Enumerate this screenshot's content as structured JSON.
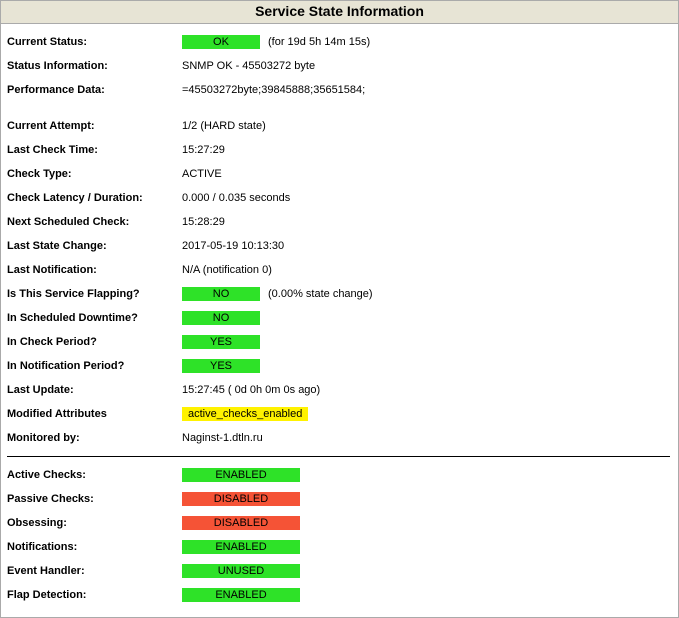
{
  "title": "Service State Information",
  "rows1": {
    "currentStatus": {
      "label": "Current Status:",
      "badge": "OK",
      "extra": "(for 19d 5h 14m 15s)"
    },
    "statusInformation": {
      "label": "Status Information:",
      "value": "SNMP OK - 45503272 byte"
    },
    "performanceData": {
      "label": "Performance Data:",
      "value": "=45503272byte;39845888;35651584;"
    }
  },
  "rows2": {
    "currentAttempt": {
      "label": "Current Attempt:",
      "value": "1/2  (HARD state)"
    },
    "lastCheckTime": {
      "label": "Last Check Time:",
      "value": "15:27:29"
    },
    "checkType": {
      "label": "Check Type:",
      "value": "ACTIVE"
    },
    "checkLatency": {
      "label": "Check Latency / Duration:",
      "value": "0.000 / 0.035 seconds"
    },
    "nextCheck": {
      "label": "Next Scheduled Check:",
      "value": "15:28:29"
    },
    "lastStateChange": {
      "label": "Last State Change:",
      "value": "2017-05-19 10:13:30"
    },
    "lastNotification": {
      "label": "Last Notification:",
      "value": "N/A (notification 0)"
    },
    "flapping": {
      "label": "Is This Service Flapping?",
      "badge": "NO",
      "extra": "(0.00% state change)"
    },
    "scheduledDowntime": {
      "label": "In Scheduled Downtime?",
      "badge": "NO"
    },
    "inCheckPeriod": {
      "label": "In Check Period?",
      "badge": "YES"
    },
    "inNotificationPeriod": {
      "label": "In Notification Period?",
      "badge": "YES"
    },
    "lastUpdate": {
      "label": "Last Update:",
      "value": "15:27:45  ( 0d 0h 0m 0s ago)"
    },
    "modifiedAttributes": {
      "label": "Modified Attributes",
      "badge": "active_checks_enabled"
    },
    "monitoredBy": {
      "label": "Monitored by:",
      "value": "Naginst-1.dtln.ru"
    }
  },
  "rows3": {
    "activeChecks": {
      "label": "Active Checks:",
      "badge": "ENABLED",
      "cls": "green"
    },
    "passiveChecks": {
      "label": "Passive Checks:",
      "badge": "DISABLED",
      "cls": "red"
    },
    "obsessing": {
      "label": "Obsessing:",
      "badge": "DISABLED",
      "cls": "red"
    },
    "notifications": {
      "label": "Notifications:",
      "badge": "ENABLED",
      "cls": "green"
    },
    "eventHandler": {
      "label": "Event Handler:",
      "badge": "UNUSED",
      "cls": "green"
    },
    "flapDetection": {
      "label": "Flap Detection:",
      "badge": "ENABLED",
      "cls": "green"
    }
  }
}
